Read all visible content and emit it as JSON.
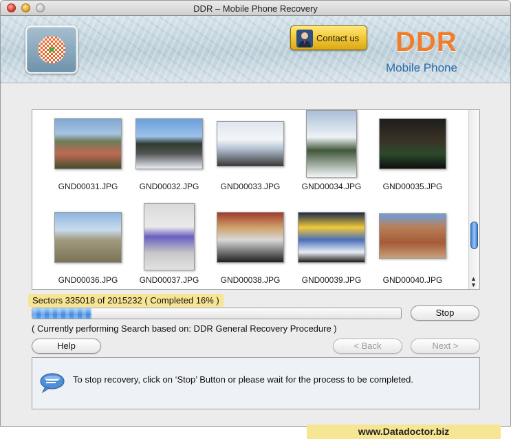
{
  "window": {
    "title": "DDR – Mobile Phone Recovery"
  },
  "header": {
    "contact_label": "Contact us",
    "brand": "DDR",
    "brand_sub": "Mobile Phone",
    "brand_color": "#ef7d2b",
    "sub_color": "#2d6bab",
    "logo_icon": "checkered-flower-logo-icon",
    "contact_icon": "person-icon"
  },
  "gallery": {
    "files": [
      {
        "name": "GND00031.JPG",
        "photo": "mountain-couple"
      },
      {
        "name": "GND00032.JPG",
        "photo": "snowy-road"
      },
      {
        "name": "GND00033.JPG",
        "photo": "bus-sign"
      },
      {
        "name": "GND00034.JPG",
        "photo": "snowy-pine"
      },
      {
        "name": "GND00035.JPG",
        "photo": "dark-forest"
      },
      {
        "name": "GND00036.JPG",
        "photo": "desert-houses"
      },
      {
        "name": "GND00037.JPG",
        "photo": "kid-in-snow"
      },
      {
        "name": "GND00038.JPG",
        "photo": "street-people"
      },
      {
        "name": "GND00039.JPG",
        "photo": "yellow-building"
      },
      {
        "name": "GND00040.JPG",
        "photo": "red-fort"
      }
    ],
    "scroll_position": 0.62
  },
  "progress": {
    "sectors_text": "Sectors 335018 of 2015232    ( Completed 16% )",
    "completed_fraction": 0.16,
    "status_text": "( Currently performing Search based on: DDR General Recovery Procedure )",
    "stop_label": "Stop"
  },
  "nav": {
    "help_label": "Help",
    "back_label": "< Back",
    "next_label": "Next >"
  },
  "info": {
    "message": "To stop recovery, click on ‘Stop’ Button or please wait for the process to be completed.",
    "icon": "speech-bubble-icon"
  },
  "footer": {
    "site": "www.Datadoctor.biz"
  }
}
